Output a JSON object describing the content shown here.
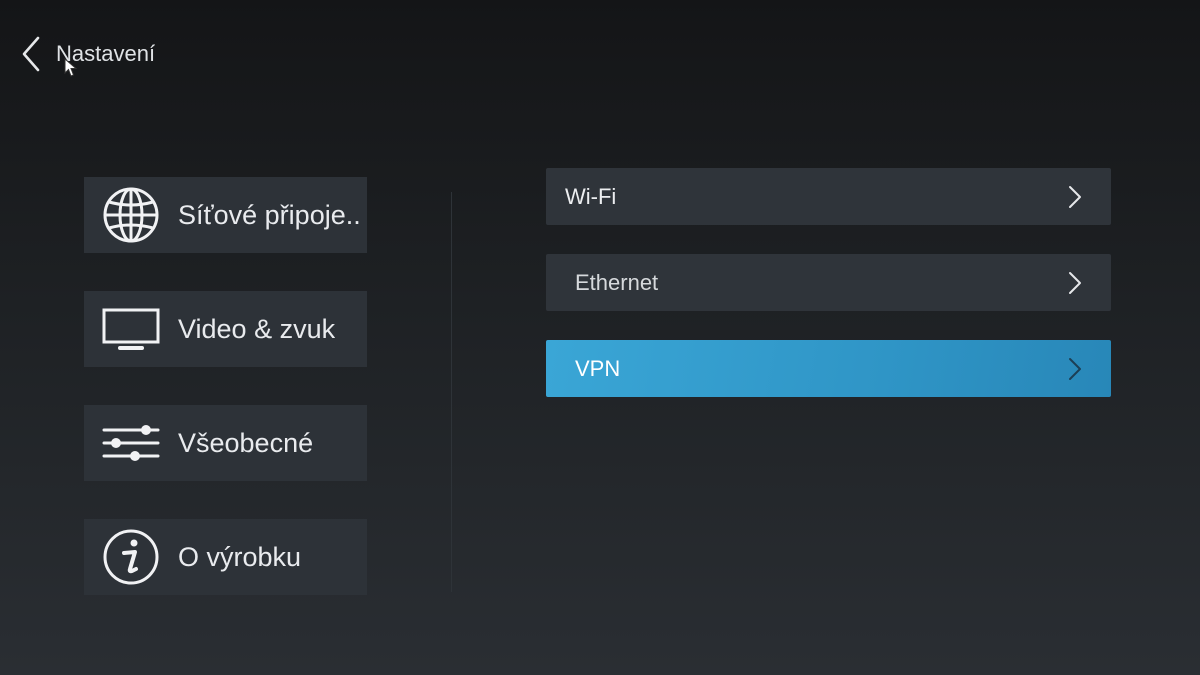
{
  "header": {
    "title": "Nastavení"
  },
  "left_menu": [
    {
      "id": "network",
      "label": "Síťové připoje..",
      "icon": "globe-icon"
    },
    {
      "id": "video",
      "label": "Video & zvuk",
      "icon": "tv-icon"
    },
    {
      "id": "general",
      "label": "Všeobecné",
      "icon": "sliders-icon"
    },
    {
      "id": "about",
      "label": "O výrobku",
      "icon": "info-icon"
    }
  ],
  "right_list": [
    {
      "label": "Wi-Fi",
      "active": false
    },
    {
      "label": "Ethernet",
      "active": false
    },
    {
      "label": "VPN",
      "active": true
    }
  ],
  "colors": {
    "accent": "#3399cc",
    "panel": "#2d3238",
    "background": "#1e2124"
  }
}
